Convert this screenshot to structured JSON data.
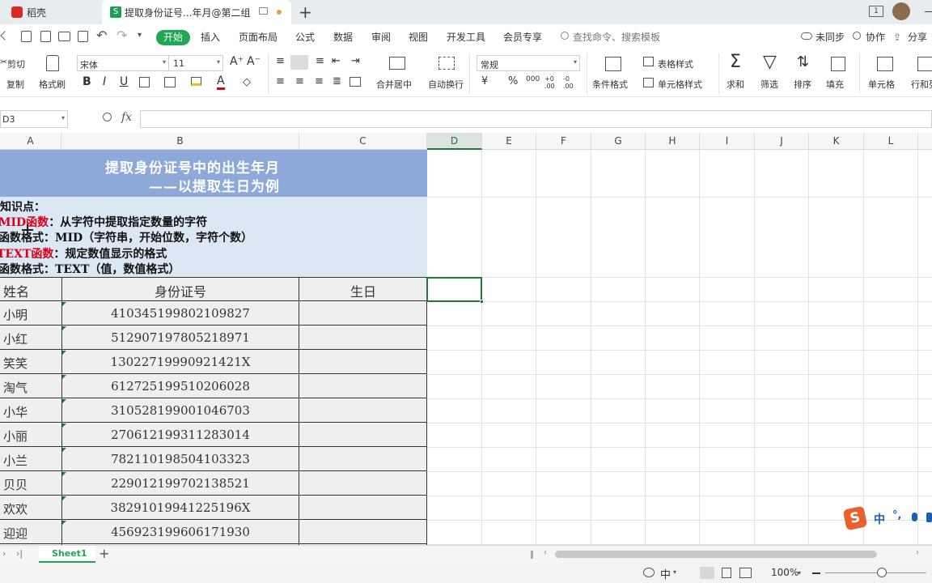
{
  "titlebar": {
    "app_tab": "稻壳",
    "doc_tab": "提取身份证号...年月@第二组",
    "new_tab_icon": "+",
    "badge": "1"
  },
  "menu": {
    "items": [
      "开始",
      "插入",
      "页面布局",
      "公式",
      "数据",
      "审阅",
      "视图",
      "开发工具",
      "会员专享"
    ],
    "search_placeholder": "查找命令、搜索模板",
    "sync": "未同步",
    "collab": "协作",
    "share": "分享"
  },
  "ribbon": {
    "cut": "剪切",
    "copy": "复制",
    "format_painter": "格式刷",
    "font_name": "宋体",
    "font_size": "11",
    "merge_center": "合并居中",
    "wrap_text": "自动换行",
    "number_format": "常规",
    "cond_format": "条件格式",
    "table_style": "表格样式",
    "cell_style": "单元格样式",
    "sum": "求和",
    "filter": "筛选",
    "sort": "排序",
    "fill": "填充",
    "cell": "单元格",
    "row_col": "行和列",
    "currency": "¥",
    "percent": "%",
    "thousands": "000",
    "dec_inc": "+0 .00",
    "dec_dec": "-0 .00"
  },
  "formula_bar": {
    "name_box": "D3",
    "fx": "fx",
    "content": ""
  },
  "columns": [
    "A",
    "B",
    "C",
    "D",
    "E",
    "F",
    "G",
    "H",
    "I",
    "J",
    "K",
    "L"
  ],
  "selected_column": "D",
  "sheet": {
    "title_line1": "提取身份证号中的出生年月",
    "title_line2": "——以提取生日为例",
    "kp_heading": "知识点：",
    "kp1_name": "MID函数",
    "kp1_text": "：从字符中提取指定数量的字符",
    "kp2": "函数格式：MID（字符串，开始位数，字符个数）",
    "kp3_name": "TEXT函数",
    "kp3_text": "：规定数值显示的格式",
    "kp4": "函数格式：TEXT（值，数值格式）",
    "header_name": "姓名",
    "header_id": "身份证号",
    "header_birthday": "生日",
    "rows": [
      {
        "name": "小明",
        "id": "410345199802109827"
      },
      {
        "name": "小红",
        "id": "512907197805218971"
      },
      {
        "name": "笑笑",
        "id": "13022719990921421X"
      },
      {
        "name": "淘气",
        "id": "612725199510206028"
      },
      {
        "name": "小华",
        "id": "310528199001046703"
      },
      {
        "name": "小丽",
        "id": "270612199311283014"
      },
      {
        "name": "小兰",
        "id": "782110198504103323"
      },
      {
        "name": "贝贝",
        "id": "229012199702138521"
      },
      {
        "name": "欢欢",
        "id": "38291019941225196X"
      },
      {
        "name": "迎迎",
        "id": "456923199606171930"
      }
    ]
  },
  "sheet_tabs": {
    "active": "Sheet1",
    "add": "+"
  },
  "status": {
    "ime": "中",
    "zoom": "100%"
  },
  "ime_bar": {
    "logo": "S",
    "text": "中"
  },
  "colors": {
    "accent_green": "#1f7a3a",
    "title_bg": "#8da9d9",
    "info_bg": "#dbe7f3",
    "table_bg": "#efefef",
    "red_text": "#d9001b"
  }
}
